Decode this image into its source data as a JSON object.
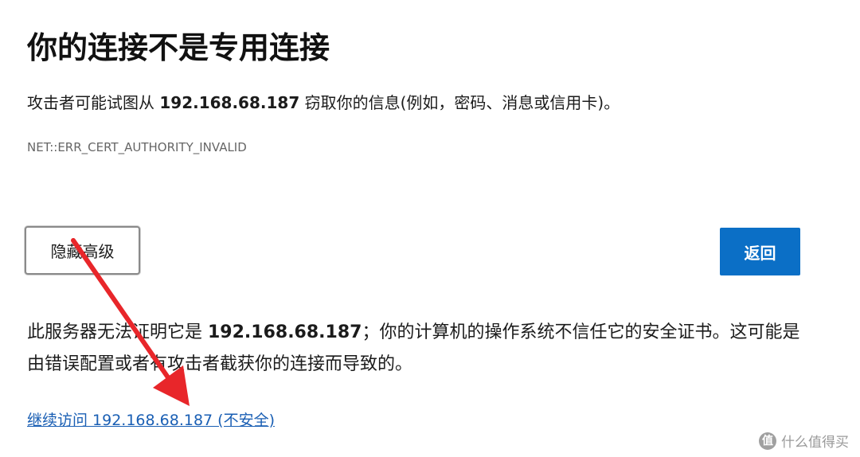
{
  "page": {
    "title": "你的连接不是专用连接",
    "description": {
      "prefix": "攻击者可能试图从 ",
      "host": "192.168.68.187",
      "suffix": " 窃取你的信息(例如，密码、消息或信用卡)。"
    },
    "error_code": "NET::ERR_CERT_AUTHORITY_INVALID",
    "buttons": {
      "advanced_label": "隐藏高级",
      "back_label": "返回"
    },
    "detail": {
      "prefix": "此服务器无法证明它是 ",
      "host": "192.168.68.187",
      "suffix": "；你的计算机的操作系统不信任它的安全证书。这可能是由错误配置或者有攻击者截获你的连接而导致的。"
    },
    "proceed_link": "继续访问 192.168.68.187 (不安全)"
  },
  "annotation": {
    "arrow_color": "#e8262a"
  },
  "watermark": {
    "logo_glyph": "值",
    "text": "什么值得买"
  }
}
